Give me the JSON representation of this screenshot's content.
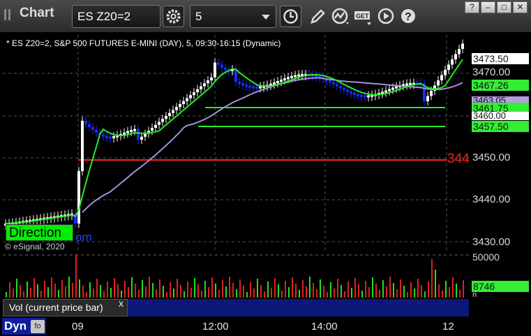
{
  "toolbar": {
    "app_title": "Chart",
    "symbol": "ES Z20=2",
    "interval": "5",
    "icons": [
      "gear-icon",
      "clock-icon",
      "pencil-icon",
      "study-icon",
      "get-icon",
      "play-icon",
      "help-icon"
    ],
    "window_buttons": [
      "?",
      "–",
      "□",
      "✕"
    ]
  },
  "chart": {
    "header": "* ES Z20=2, S&P 500 FUTURES E-MINI (DAY), 5, 09:30-16:15 (Dynamic)",
    "direction_label": "Direction",
    "link_text": "om",
    "copyright": "© eSignal, 2020",
    "red_marker_text": "344",
    "price_axis": [
      "3470.00",
      "3460.00",
      "3450.00",
      "3440.00",
      "3430.00"
    ],
    "price_tags": [
      {
        "text": "3473.50",
        "bg": "#ffffff"
      },
      {
        "text": "3467.26",
        "bg": "#33ee33"
      },
      {
        "text": "3463.05",
        "bg": "#b49ee0"
      },
      {
        "text": "3461.75",
        "bg": "#33ee33"
      },
      {
        "text": "3460.00",
        "bg": "#ffffff"
      },
      {
        "text": "3457.50",
        "bg": "#33ee33"
      }
    ],
    "volume_axis_label": "50000",
    "volume_tag": "8746",
    "volume_tag_suffix": "n",
    "study_label": "Vol (current price bar)",
    "study_close": "x",
    "dyn_label": "Dyn",
    "time_axis": [
      "09",
      "12:00",
      "14:00",
      "12"
    ],
    "colors": {
      "up": "#ffffff",
      "down": "#1a2cff",
      "ma_red": "#ff2020",
      "ma_green": "#22ee22",
      "ma_purple": "#a98be0",
      "vol_red": "#e02020",
      "vol_green": "#22dd22"
    }
  }
}
